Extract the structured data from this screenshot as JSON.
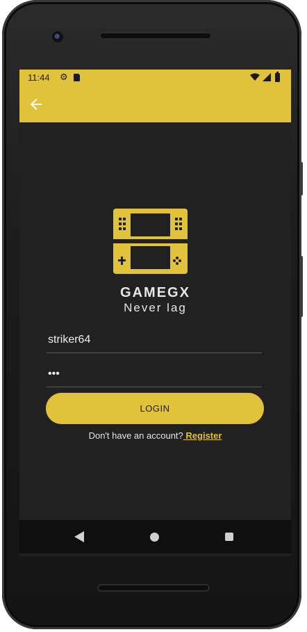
{
  "status": {
    "time": "11:44"
  },
  "icons": {
    "back": "arrow-back-icon",
    "settings": "gear-icon",
    "sd": "sd-card-icon",
    "wifi": "wifi-icon",
    "signal": "signal-icon",
    "battery": "battery-icon",
    "logo": "handheld-console-icon"
  },
  "brand": {
    "name": "GAMEGX",
    "tagline": "Never lag"
  },
  "form": {
    "username_value": "striker64",
    "password_value": "•••",
    "login_label": "LOGIN"
  },
  "register": {
    "prompt": "Don't have an account?",
    "link": " Register"
  },
  "colors": {
    "accent": "#e0c23b",
    "background": "#212121"
  }
}
